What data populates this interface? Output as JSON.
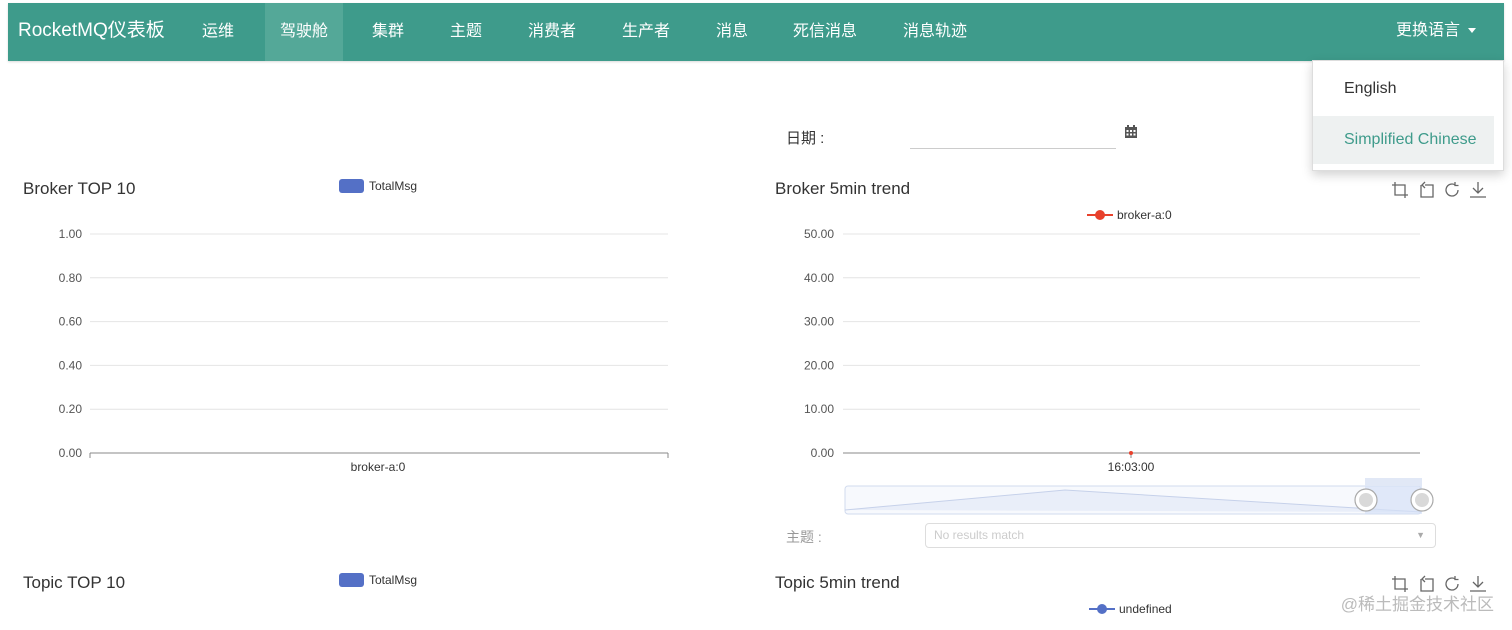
{
  "navbar": {
    "brand": "RocketMQ仪表板",
    "items": [
      {
        "label": "运维",
        "active": false
      },
      {
        "label": "驾驶舱",
        "active": true
      },
      {
        "label": "集群",
        "active": false
      },
      {
        "label": "主题",
        "active": false
      },
      {
        "label": "消费者",
        "active": false
      },
      {
        "label": "生产者",
        "active": false
      },
      {
        "label": "消息",
        "active": false
      },
      {
        "label": "死信消息",
        "active": false
      },
      {
        "label": "消息轨迹",
        "active": false
      }
    ],
    "language_toggle": "更换语言",
    "language_options": [
      "English",
      "Simplified Chinese"
    ],
    "language_selected": "Simplified Chinese"
  },
  "date_filter": {
    "label": "日期 :",
    "value": ""
  },
  "topic_filter": {
    "label": "主题 :",
    "placeholder": "No results match"
  },
  "panels": {
    "broker_top": {
      "title": "Broker TOP 10",
      "legend": "TotalMsg"
    },
    "broker_trend": {
      "title": "Broker 5min trend",
      "legend": "broker-a:0"
    },
    "topic_top": {
      "title": "Topic TOP 10",
      "legend": "TotalMsg"
    },
    "topic_trend": {
      "title": "Topic 5min trend",
      "legend": "undefined"
    }
  },
  "watermark": "@稀土掘金技术社区",
  "colors": {
    "navbar": "#3e9b8b",
    "bar_series": "#5470c6",
    "line_series": "#e8412c",
    "topic_series": "#5470c6"
  },
  "chart_data": [
    {
      "type": "bar",
      "title": "Broker TOP 10",
      "categories": [
        "broker-a:0"
      ],
      "series": [
        {
          "name": "TotalMsg",
          "values": [
            0
          ]
        }
      ],
      "ylim": [
        0,
        1
      ],
      "yticks": [
        "0.00",
        "0.20",
        "0.40",
        "0.60",
        "0.80",
        "1.00"
      ],
      "grid": true,
      "legend": "top"
    },
    {
      "type": "line",
      "title": "Broker 5min trend",
      "x": [
        "16:03:00"
      ],
      "series": [
        {
          "name": "broker-a:0",
          "values": [
            0
          ]
        }
      ],
      "ylim": [
        0,
        50
      ],
      "yticks": [
        "0.00",
        "10.00",
        "20.00",
        "30.00",
        "40.00",
        "50.00"
      ],
      "grid": true,
      "legend": "top",
      "data_zoom": true
    }
  ]
}
